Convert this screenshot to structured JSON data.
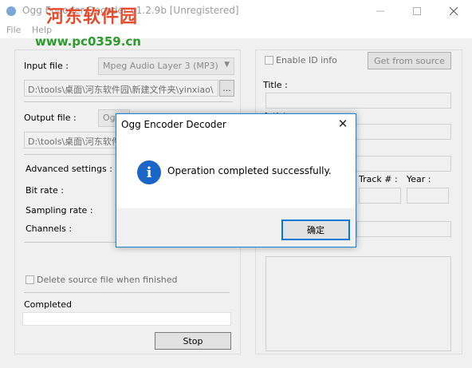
{
  "window": {
    "title": "Ogg Encoder Decoder v1.2.9b [Unregistered]",
    "menu": [
      "File",
      "Help"
    ]
  },
  "watermark": {
    "brand": "河东软件园",
    "url": "www.pc0359.cn"
  },
  "left": {
    "input_label": "Input file :",
    "input_format": "Mpeg Audio Layer 3 (MP3)",
    "input_path": "D:\\tools\\桌面\\河东软件园\\新建文件夹\\yinxiao\\",
    "browse_label": "...",
    "output_label": "Output file :",
    "output_format": "Og",
    "output_path": "D:\\tools\\桌面\\河东软件",
    "advanced_label": "Advanced settings :",
    "bitrate_label": "Bit rate :",
    "sampling_label": "Sampling rate :",
    "channels_label": "Channels :",
    "delete_label": "Delete source file when finished",
    "status_label": "Completed",
    "stop_label": "Stop"
  },
  "right": {
    "enable_id_label": "Enable ID info",
    "get_source_label": "Get from source",
    "title_label": "Title :",
    "artist_label": "Artist :",
    "track_label": "Track # :",
    "year_label": "Year :"
  },
  "dialog": {
    "title": "Ogg Encoder Decoder",
    "close_glyph": "✕",
    "message": "Operation completed successfully.",
    "icon_glyph": "i",
    "ok_label": "确定"
  },
  "colors": {
    "accent": "#0078d7",
    "info_icon": "#1a66c8",
    "watermark_red": "#e74b2c",
    "watermark_green": "#2c9c2c"
  }
}
